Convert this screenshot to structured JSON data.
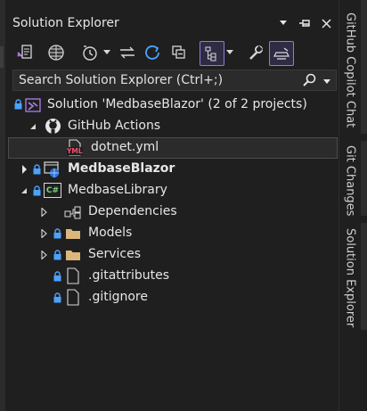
{
  "panel": {
    "title": "Solution Explorer"
  },
  "search": {
    "placeholder": "Search Solution Explorer (Ctrl+;)"
  },
  "tree": {
    "solution_label": "Solution 'MedbaseBlazor' (2 of 2 projects)",
    "github_actions_label": "GitHub Actions",
    "dotnet_file_label": "dotnet.yml",
    "yml_badge": "YML",
    "project_blazor_label": "MedbaseBlazor",
    "project_library_label": "MedbaseLibrary",
    "csharp_badge": "C#",
    "dependencies_label": "Dependencies",
    "models_label": "Models",
    "services_label": "Services",
    "gitattributes_label": ".gitattributes",
    "gitignore_label": ".gitignore"
  },
  "side_tabs": {
    "copilot": "GitHub Copilot Chat",
    "git_changes": "Git Changes",
    "solution_explorer": "Solution Explorer"
  },
  "colors": {
    "background": "#1f1f1f",
    "accent": "#8a7fd6",
    "lock_blue": "#4aa3ff",
    "folder_yellow": "#dcb67a"
  }
}
